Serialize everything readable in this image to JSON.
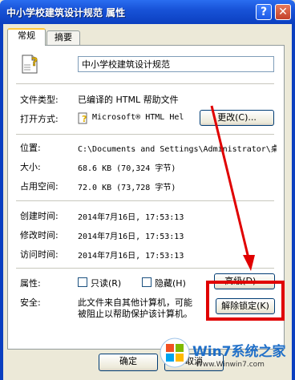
{
  "window": {
    "title": "中小学校建筑设计规范 属性"
  },
  "titlebar_buttons": {
    "help": "?",
    "close": "✕"
  },
  "tabs": [
    "常规",
    "摘要"
  ],
  "general": {
    "file_name": "中小学校建筑设计规范",
    "file_type_label": "文件类型:",
    "file_type_value": "已编译的 HTML 帮助文件",
    "open_with_label": "打开方式:",
    "open_with_value": "Microsoft® HTML Hel",
    "change_button": "更改(C)...",
    "location_label": "位置:",
    "location_value": "C:\\Documents and Settings\\Administrator\\桌",
    "size_label": "大小:",
    "size_value": "68.6 KB (70,324 字节)",
    "size_on_disk_label": "占用空间:",
    "size_on_disk_value": "72.0 KB (73,728 字节)",
    "created_label": "创建时间:",
    "created_value": "2014年7月16日, 17:53:13",
    "modified_label": "修改时间:",
    "modified_value": "2014年7月16日, 17:53:13",
    "accessed_label": "访问时间:",
    "accessed_value": "2014年7月16日, 17:53:13",
    "attributes_label": "属性:",
    "readonly_label": "只读(R)",
    "hidden_label": "隐藏(H)",
    "advanced_button": "高级(D)...",
    "security_label": "安全:",
    "security_text_line1": "此文件来自其他计算机，可能",
    "security_text_line2": "被阻止以帮助保护该计算机。",
    "unblock_button": "解除锁定(K)"
  },
  "footer": {
    "ok_button": "确定",
    "cancel_button": "取消"
  },
  "watermark": {
    "brand": "Win7系统之家",
    "url": "Www.Winwin7.com"
  },
  "colors": {
    "highlight": "#e00000",
    "titlebar": "#1853d8"
  },
  "icons": {
    "file": "help-file-icon",
    "open_with": "help-app-icon"
  }
}
